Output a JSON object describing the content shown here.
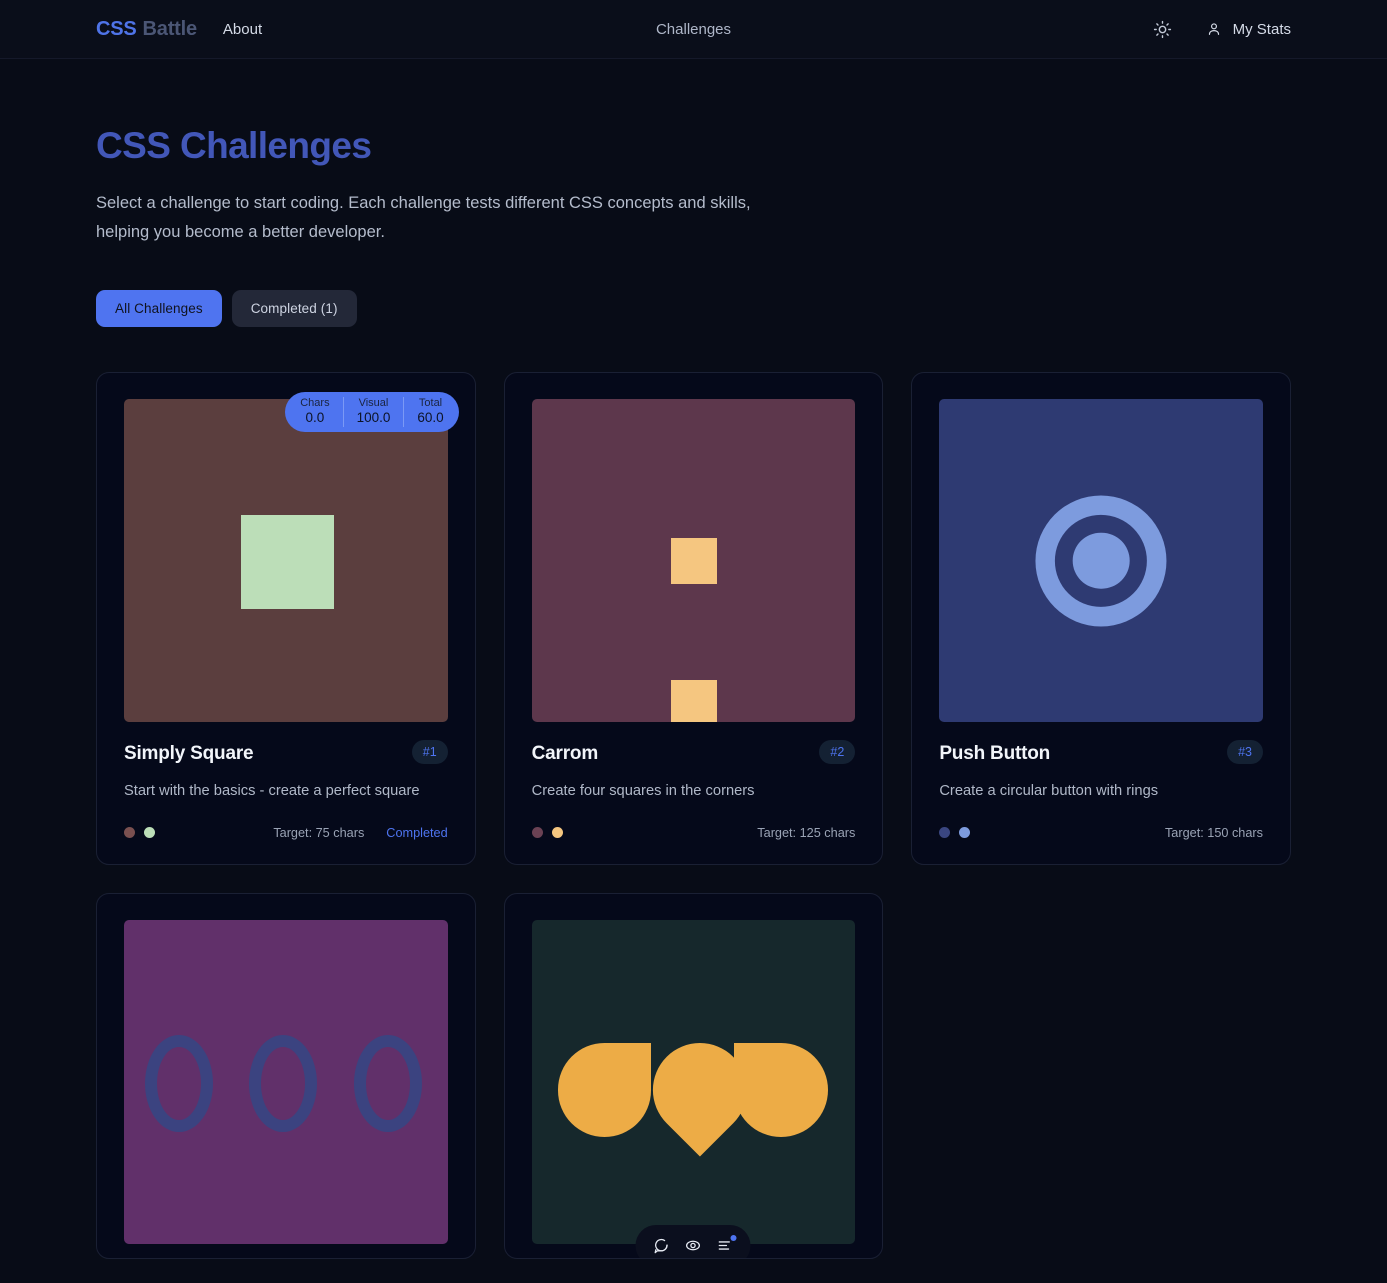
{
  "header": {
    "brand_primary": "CSS",
    "brand_secondary": "Battle",
    "about_label": "About",
    "center_label": "Challenges",
    "theme_icon": "sun-icon",
    "user_icon": "user-icon",
    "my_stats_label": "My Stats"
  },
  "page": {
    "title": "CSS Challenges",
    "subtitle": "Select a challenge to start coding. Each challenge tests different CSS concepts and skills, helping you become a better developer."
  },
  "filters": [
    {
      "label": "All Challenges",
      "active": true
    },
    {
      "label": "Completed (1)",
      "active": false
    }
  ],
  "score_pill": {
    "segments": [
      {
        "label": "Chars",
        "value": "0.0"
      },
      {
        "label": "Visual",
        "value": "100.0"
      },
      {
        "label": "Total",
        "value": "60.0"
      }
    ]
  },
  "cards": [
    {
      "title": "Simply Square",
      "rank": "#1",
      "description": "Start with the basics - create a perfect square",
      "target": "Target: 75 chars",
      "status": "Completed",
      "swatches": [
        "#5B3E3E",
        "#BCDEB8"
      ],
      "thumb_bg": "#5B3E3E",
      "art": "square"
    },
    {
      "title": "Carrom",
      "rank": "#2",
      "description": "Create four squares in the corners",
      "target": "Target: 125 chars",
      "status": "",
      "swatches": [
        "#5D374C",
        "#F5C680"
      ],
      "thumb_bg": "#5D374C",
      "art": "carrom"
    },
    {
      "title": "Push Button",
      "rank": "#3",
      "description": "Create a circular button with rings",
      "target": "Target: 150 chars",
      "status": "",
      "swatches": [
        "#2E3A72",
        "#7D9BDE"
      ],
      "thumb_bg": "#2E3A72",
      "art": "rings"
    },
    {
      "title": "",
      "rank": "",
      "description": "",
      "target": "",
      "status": "",
      "swatches": [],
      "thumb_bg": "#61306A",
      "art": "ovals"
    },
    {
      "title": "",
      "rank": "",
      "description": "",
      "target": "",
      "status": "",
      "swatches": [],
      "thumb_bg": "#16282C",
      "art": "drops"
    }
  ],
  "dock": {
    "icons": [
      "chat-icon",
      "eye-icon",
      "list-icon"
    ],
    "badge_color": "#4E74F0"
  },
  "colors": {
    "accent": "#4E74F0",
    "page_bg": "#080C17",
    "card_bg": "#05091A"
  }
}
